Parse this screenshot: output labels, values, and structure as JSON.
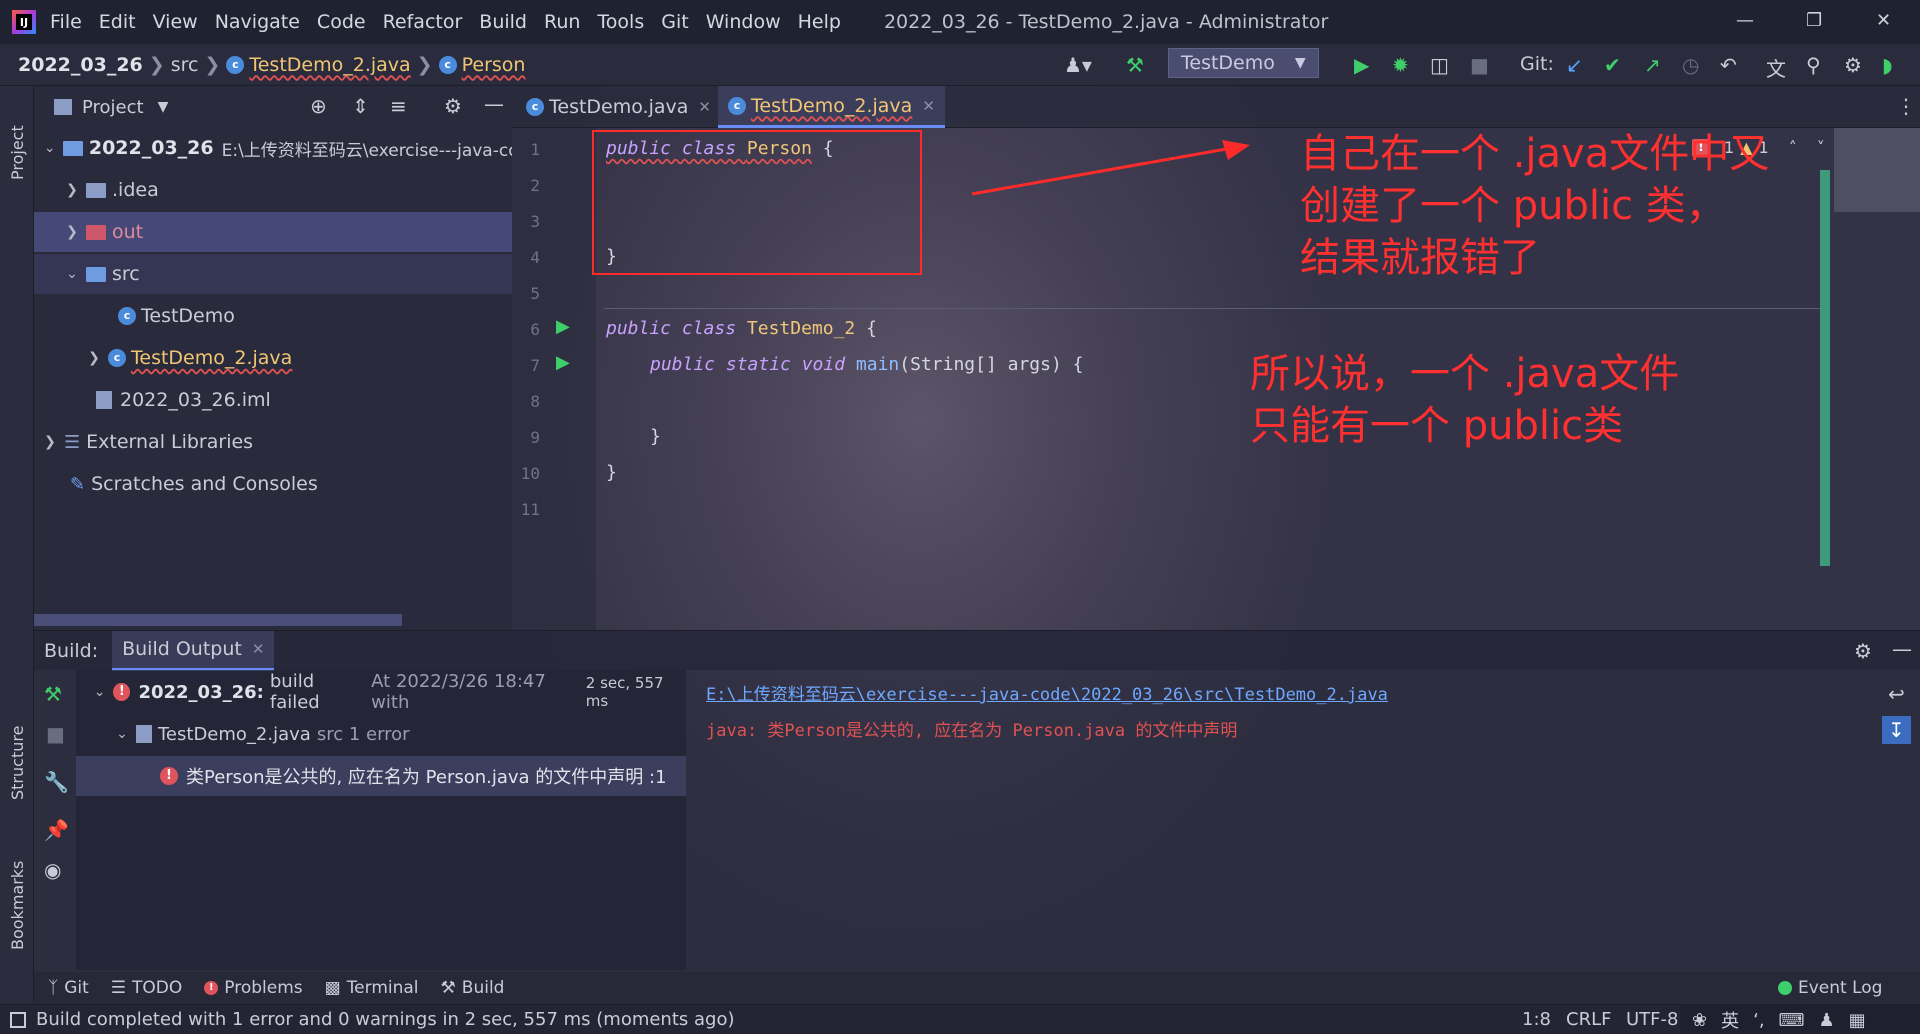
{
  "menubar": {
    "items": [
      "File",
      "Edit",
      "View",
      "Navigate",
      "Code",
      "Refactor",
      "Build",
      "Run",
      "Tools",
      "Git",
      "Window",
      "Help"
    ],
    "window_title": "2022_03_26 - TestDemo_2.java - Administrator"
  },
  "breadcrumb": {
    "project": "2022_03_26",
    "folder": "src",
    "file": "TestDemo_2.java",
    "class": "Person"
  },
  "toolbar": {
    "run_config": "TestDemo",
    "git_label": "Git:"
  },
  "project_panel": {
    "title": "Project",
    "root_name": "2022_03_26",
    "root_path": "E:\\上传资料至码云\\exercise---java-co",
    "items": [
      ".idea",
      "out",
      "src",
      "TestDemo",
      "TestDemo_2.java",
      "2022_03_26.iml",
      "External Libraries",
      "Scratches and Consoles"
    ]
  },
  "left_strip": {
    "project_label": "Project",
    "structure_label": "Structure",
    "bookmarks_label": "Bookmarks"
  },
  "editor": {
    "tabs": [
      "TestDemo.java",
      "TestDemo_2.java"
    ],
    "line_numbers": [
      "1",
      "2",
      "3",
      "4",
      "5",
      "6",
      "7",
      "8",
      "9",
      "10",
      "11"
    ],
    "code": {
      "l1_kw": "public class ",
      "l1_cls": "Person",
      "l1_rest": " {",
      "l4": "}",
      "l6_kw": "public class ",
      "l6_cls": "TestDemo_2",
      "l6_rest": " {",
      "l7_kw": "public static void ",
      "l7_fn": "main",
      "l7_rest": "(String[] args) {",
      "l9": "}",
      "l10": "}"
    },
    "inspection_count": "1",
    "inspection_errors": "1"
  },
  "annotations": {
    "note1_line1": "自己在一个 .java文件中又",
    "note1_line2": "创建了一个 public 类，",
    "note1_line3": "结果就报错了",
    "note2_line1": "所以说，一个 .java文件",
    "note2_line2": "只能有一个 public类"
  },
  "build": {
    "label": "Build:",
    "tab": "Build Output",
    "root_name": "2022_03_26:",
    "root_status": "build failed",
    "root_time": "At 2022/3/26 18:47 with",
    "root_duration": "2 sec, 557 ms",
    "file_name": "TestDemo_2.java",
    "file_meta": "src 1 error",
    "error_message": "类Person是公共的, 应在名为 Person.java 的文件中声明 :1",
    "output_path": "E:\\上传资料至码云\\exercise---java-code\\2022_03_26\\src\\TestDemo_2.java",
    "output_error": "java: 类Person是公共的, 应在名为 Person.java 的文件中声明"
  },
  "bottom_tabs": [
    "Git",
    "TODO",
    "Problems",
    "Terminal",
    "Build"
  ],
  "event_log": "Event Log",
  "statusbar": {
    "message": "Build completed with 1 error and 0 warnings in 2 sec, 557 ms (moments ago)",
    "position": "1:8",
    "line_ending": "CRLF",
    "encoding": "UTF-8",
    "ime_lang": "英"
  },
  "colors": {
    "accent": "#6a8cf5",
    "error": "#e0545c",
    "annotation": "#ff3030",
    "run_green": "#3fcf6a"
  }
}
